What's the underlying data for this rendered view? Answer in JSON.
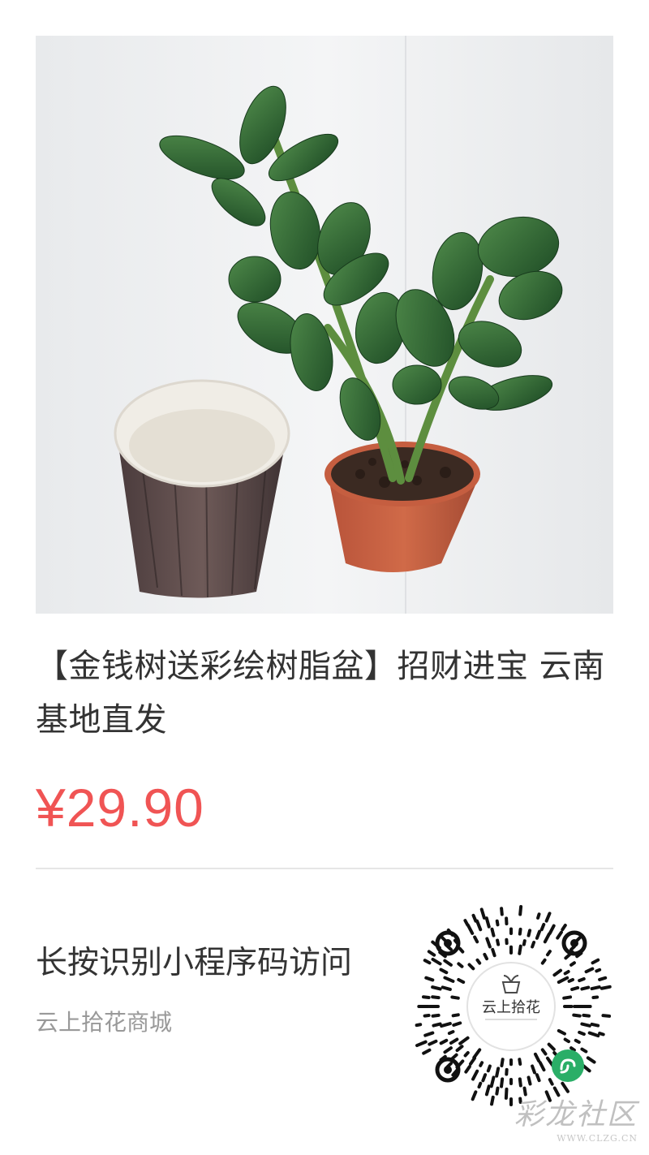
{
  "product": {
    "title": "【金钱树送彩绘树脂盆】招财进宝 云南基地直发",
    "price": "¥29.90"
  },
  "mini_program": {
    "cta": "长按识别小程序码访问",
    "shop_name": "云上拾花商城",
    "qr_logo_text": "云上拾花"
  },
  "watermark": {
    "name": "彩龙社区",
    "url": "WWW.CLZG.CN"
  },
  "colors": {
    "price": "#f05454",
    "title": "#333333",
    "subtext": "#999999",
    "wechat_badge": "#2aae67"
  }
}
